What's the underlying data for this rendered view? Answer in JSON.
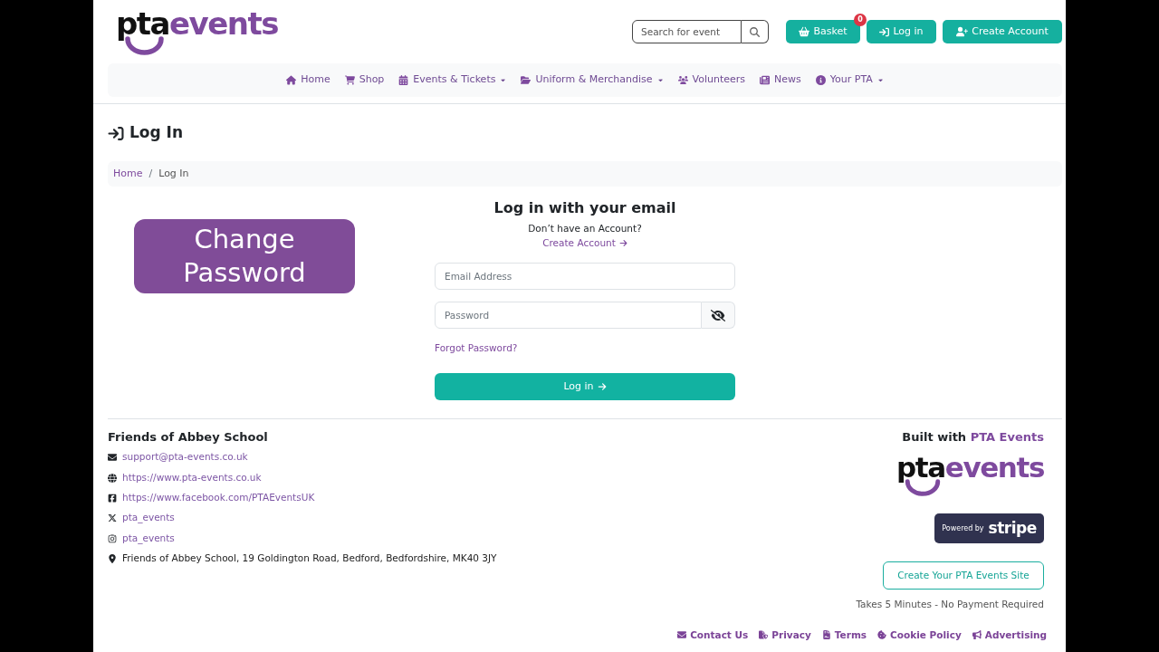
{
  "header": {
    "logo": {
      "dark_text": "pta",
      "accent_text": "events"
    },
    "search": {
      "placeholder": "Search for event"
    },
    "basket": {
      "label": "Basket",
      "count": "0"
    },
    "login_button": "Log in",
    "create_account_button": "Create Account"
  },
  "nav": [
    {
      "label": "Home",
      "dropdown": false
    },
    {
      "label": "Shop",
      "dropdown": false
    },
    {
      "label": "Events & Tickets",
      "dropdown": true
    },
    {
      "label": "Uniform & Merchandise",
      "dropdown": true
    },
    {
      "label": "Volunteers",
      "dropdown": false
    },
    {
      "label": "News",
      "dropdown": false
    },
    {
      "label": "Your PTA",
      "dropdown": true
    }
  ],
  "page_title": "Log In",
  "breadcrumb": {
    "separator": "/",
    "items": [
      {
        "label": "Home",
        "selected": false
      },
      {
        "label": "Log In",
        "selected": true
      }
    ]
  },
  "banner": "Change Password",
  "login_form": {
    "heading": "Log in with your email",
    "prompt": "Don’t have an Account?",
    "create_link": "Create Account",
    "email": {
      "placeholder": "Email Address"
    },
    "password": {
      "placeholder": "Password"
    },
    "forgot_link": "Forgot Password?",
    "submit": "Log in"
  },
  "footer": {
    "organisation": "Friends of Abbey School",
    "contacts": [
      {
        "kind": "email",
        "text": "support@pta-events.co.uk"
      },
      {
        "kind": "website",
        "text": "https://www.pta-events.co.uk"
      },
      {
        "kind": "facebook",
        "text": "https://www.facebook.com/PTAEventsUK"
      },
      {
        "kind": "x",
        "text": "pta_events"
      },
      {
        "kind": "instagram",
        "text": "pta_events"
      },
      {
        "kind": "address",
        "text": "Friends of Abbey School, 19 Goldington Road, Bedford, Bedfordshire, MK40 3JY"
      }
    ],
    "built_with": {
      "text": "Built with",
      "link": "PTA Events"
    },
    "logo": {
      "dark_text": "pta",
      "accent_text": "events"
    },
    "stripe_badge": {
      "small_text": "Powered by",
      "brand": "stripe"
    },
    "site_button": "Create Your PTA Events Site",
    "note": "Takes 5 Minutes - No Payment Required",
    "links": [
      "Contact Us",
      "Privacy",
      "Terms",
      "Cookie Policy",
      "Advertising"
    ]
  }
}
